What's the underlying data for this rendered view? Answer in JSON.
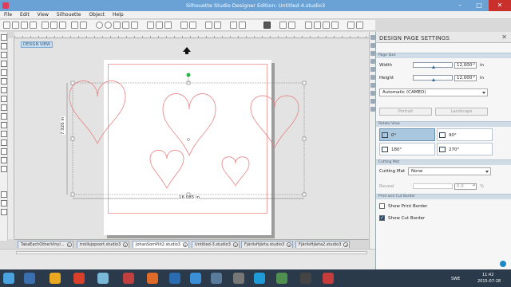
{
  "window": {
    "title": "Silhouette Studio Designer Edition: Untitled-4.studio3"
  },
  "menu": [
    "File",
    "Edit",
    "View",
    "Silhouette",
    "Object",
    "Help"
  ],
  "canvas": {
    "view_tag": "DESIGN VIEW",
    "width_label": "16.085 in",
    "height_label": "7.926 in"
  },
  "doc_tabs": [
    {
      "label": "TakaEachOtherVinyl...",
      "active": false
    },
    {
      "label": "troillsjopsort.studio3",
      "active": false
    },
    {
      "label": "JohanSomPilt2.studio3",
      "active": true
    },
    {
      "label": "Untitled-3.studio3",
      "active": false
    },
    {
      "label": "FjärilsHjärta.studio3",
      "active": false
    },
    {
      "label": "FjärilsHjärta2.studio3",
      "active": false
    }
  ],
  "panel": {
    "title": "DESIGN PAGE SETTINGS",
    "page_size": {
      "section": "Page Size",
      "width_label": "Width",
      "width_value": "12,000",
      "width_fraction": 0.5,
      "height_label": "Height",
      "height_value": "12,000",
      "height_fraction": 0.5,
      "unit": "in",
      "preset": "Automatic (CAMEO)",
      "portrait": "Portrait",
      "landscape": "Landscape"
    },
    "rotate_view": {
      "section": "Rotate View",
      "options": [
        "0°",
        "90°",
        "180°",
        "270°"
      ],
      "selected": "0°"
    },
    "cutting_mat": {
      "section": "Cutting Mat",
      "label": "Cutting Mat",
      "value": "None",
      "reveal_label": "Reveal",
      "reveal_value": "0.0",
      "reveal_unit": "%"
    },
    "borders": {
      "section": "Print and Cut Border",
      "show_print_border": "Show Print Border",
      "show_print_checked": false,
      "show_cut_border": "Show Cut Border",
      "show_cut_checked": true
    }
  },
  "taskbar": {
    "lang": "SWE",
    "time": "11:42",
    "date": "2015-07-28"
  },
  "colors": {
    "accent": "#6aa2d6",
    "heart_stroke": "#e97a7a",
    "selection": "#a9c7de"
  }
}
